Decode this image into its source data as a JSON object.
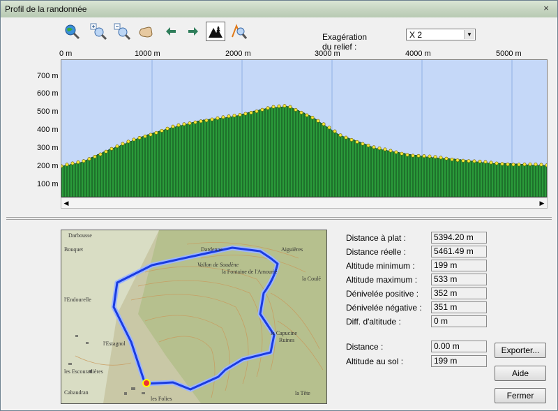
{
  "window": {
    "title": "Profil de la randonnée",
    "close_symbol": "×"
  },
  "toolbar": {
    "tools": [
      "zoom-globe-icon",
      "zoom-in-icon",
      "zoom-out-icon",
      "pan-hand-icon",
      "arrow-left-icon",
      "arrow-right-icon",
      "relief-profile-icon",
      "measure-icon"
    ],
    "exaggeration_label": "Exagération du relief :",
    "exaggeration_value": "X 2"
  },
  "profile": {
    "x_ticks": [
      "0 m",
      "1000 m",
      "2000 m",
      "3000 m",
      "4000 m",
      "5000 m"
    ],
    "y_ticks": [
      "700 m",
      "600 m",
      "500 m",
      "400 m",
      "300 m",
      "200 m",
      "100 m"
    ],
    "fill_color": "#2a9a3a",
    "sky_color": "#c5d8f8"
  },
  "stats": {
    "flat_distance_label": "Distance à plat :",
    "flat_distance": "5394.20 m",
    "real_distance_label": "Distance réelle :",
    "real_distance": "5461.49 m",
    "alt_min_label": "Altitude minimum :",
    "alt_min": "199 m",
    "alt_max_label": "Altitude maximum :",
    "alt_max": "533 m",
    "gain_label": "Dénivelée positive :",
    "gain": "352 m",
    "loss_label": "Dénivelée négative :",
    "loss": "351 m",
    "diff_label": "Diff. d'altitude :",
    "diff": "0 m",
    "distance_label": "Distance :",
    "distance": "0.00 m",
    "ground_alt_label": "Altitude au sol :",
    "ground_alt": "199 m"
  },
  "buttons": {
    "export": "Exporter...",
    "help": "Aide",
    "close": "Fermer"
  },
  "map": {
    "labels": [
      "Darbousse",
      "Bouquet",
      "l'Endourelle",
      "l'Estagnol",
      "les Escouradières",
      "Cabaudran",
      "les Folies",
      "Vallon de Soudène",
      "la Fontaine de l'Amourié",
      "Aiguières",
      "la Capucine",
      "Ruines",
      "la Tête",
      "Dardenne",
      "la Coulé"
    ],
    "route_color": "#1a3ce0"
  }
}
